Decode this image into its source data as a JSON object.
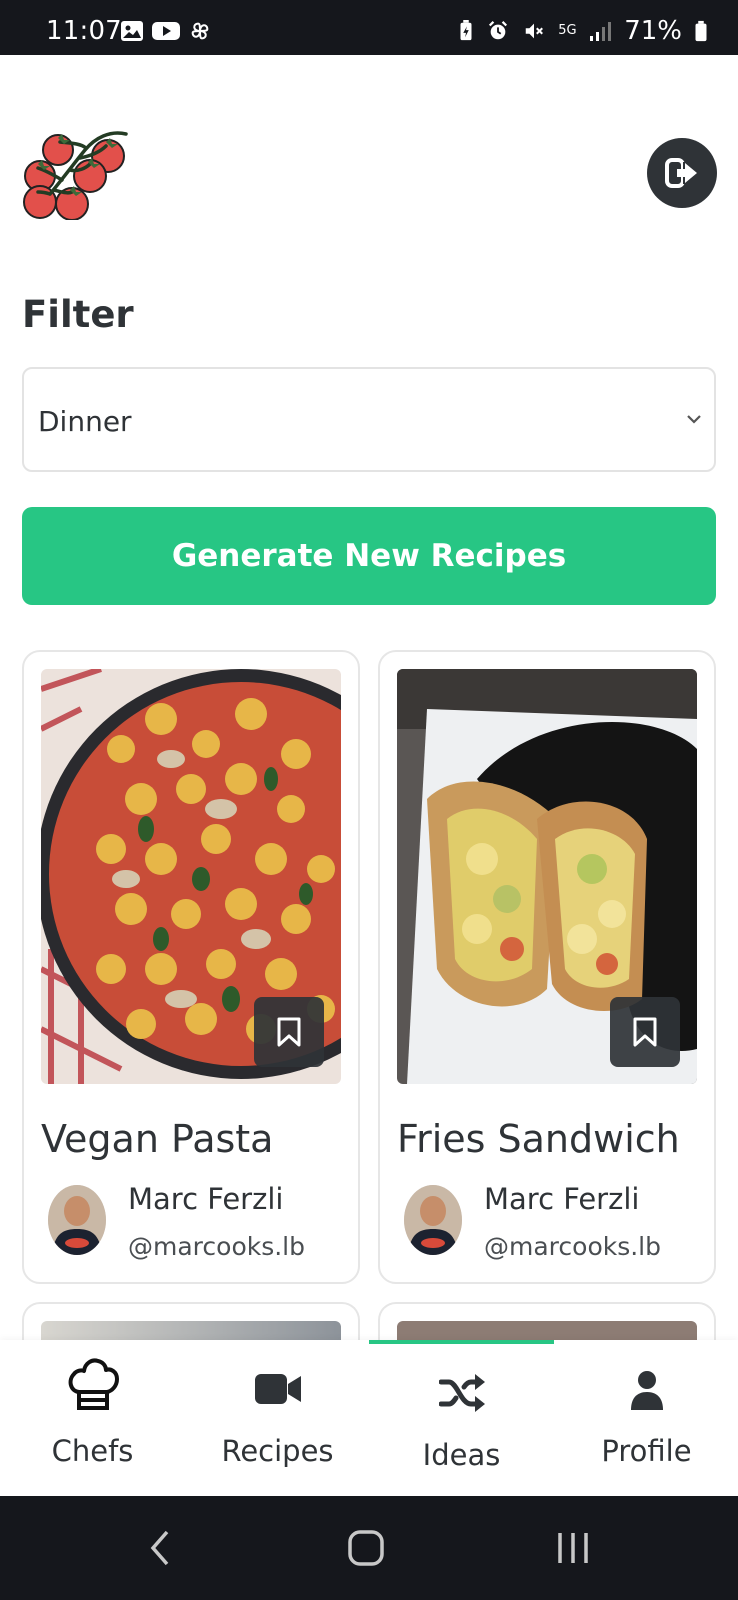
{
  "status_bar": {
    "time": "11:07",
    "battery": "71%",
    "network": "5G",
    "left_icons": [
      "gallery-icon",
      "youtube-icon",
      "pinwheel-icon"
    ],
    "right_icons": [
      "battery-saver-icon",
      "alarm-icon",
      "mute-icon",
      "network-5g-icon",
      "signal-icon",
      "battery-icon"
    ]
  },
  "header": {
    "logo_icon": "tomato-vine-logo",
    "logout_icon": "logout-icon"
  },
  "filter": {
    "title": "Filter",
    "selected": "Dinner"
  },
  "actions": {
    "generate_label": "Generate New Recipes"
  },
  "recipes": [
    {
      "title": "Vegan Pasta",
      "author": "Marc Ferzli",
      "handle": "@marcooks.lb"
    },
    {
      "title": "Fries Sandwich",
      "author": "Marc Ferzli",
      "handle": "@marcooks.lb"
    }
  ],
  "nav": {
    "items": [
      {
        "label": "Chefs",
        "icon": "chef-hat-icon"
      },
      {
        "label": "Recipes",
        "icon": "video-camera-icon"
      },
      {
        "label": "Ideas",
        "icon": "shuffle-icon"
      },
      {
        "label": "Profile",
        "icon": "user-icon"
      }
    ],
    "active": "Ideas"
  },
  "colors": {
    "accent": "#27c684",
    "dark": "#2f3337",
    "system_bar": "#15171c"
  }
}
